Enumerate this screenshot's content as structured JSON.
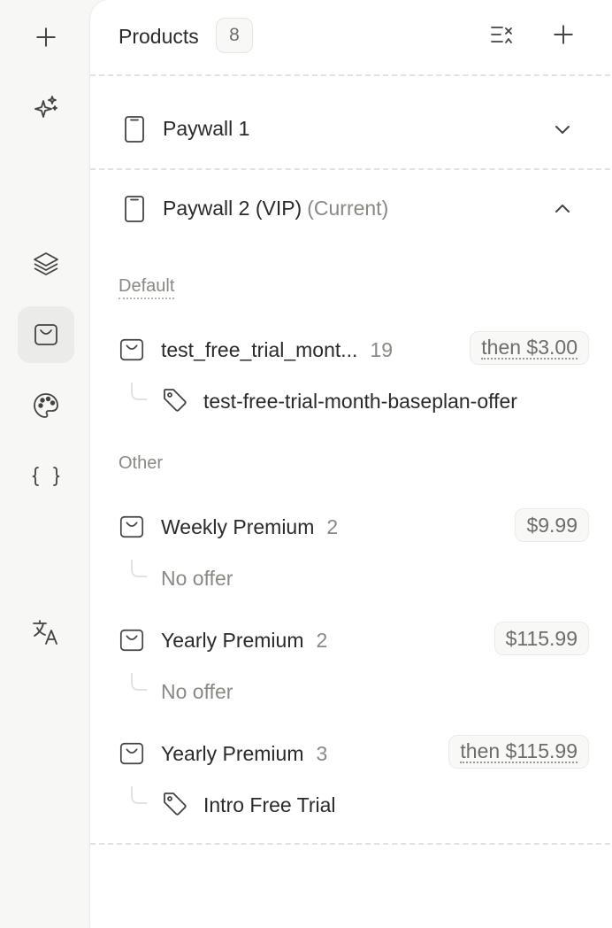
{
  "rail": {
    "items": [
      {
        "icon": "plus-icon"
      },
      {
        "icon": "sparkles-icon"
      },
      {
        "icon": "layers-icon"
      },
      {
        "icon": "shopping-bag-icon",
        "active": true
      },
      {
        "icon": "palette-icon"
      },
      {
        "icon": "braces-icon"
      },
      {
        "icon": "translate-icon"
      }
    ]
  },
  "header": {
    "title": "Products",
    "count": "8"
  },
  "paywalls": [
    {
      "name": "Paywall 1",
      "sub": "",
      "expanded": false
    },
    {
      "name": "Paywall 2 (VIP)",
      "sub": "(Current)",
      "expanded": true
    }
  ],
  "groups": {
    "default_label": "Default",
    "other_label": "Other"
  },
  "products": [
    {
      "name": "test_free_trial_mont...",
      "count": "19",
      "price": "then $3.00",
      "offer": "test-free-trial-month-baseplan-offer",
      "has_offer": true
    },
    {
      "name": "Weekly Premium",
      "count": "2",
      "price": "$9.99",
      "offer": "No offer",
      "has_offer": false
    },
    {
      "name": "Yearly Premium",
      "count": "2",
      "price": "$115.99",
      "offer": "No offer",
      "has_offer": false
    },
    {
      "name": "Yearly Premium",
      "count": "3",
      "price": "then $115.99",
      "offer": "Intro Free Trial",
      "has_offer": true
    }
  ],
  "colors": {
    "panel_bg": "#ffffff",
    "rail_bg": "#f7f7f6",
    "active_rail": "#ebebea",
    "text": "#2b2a28",
    "muted": "#8a8883"
  }
}
